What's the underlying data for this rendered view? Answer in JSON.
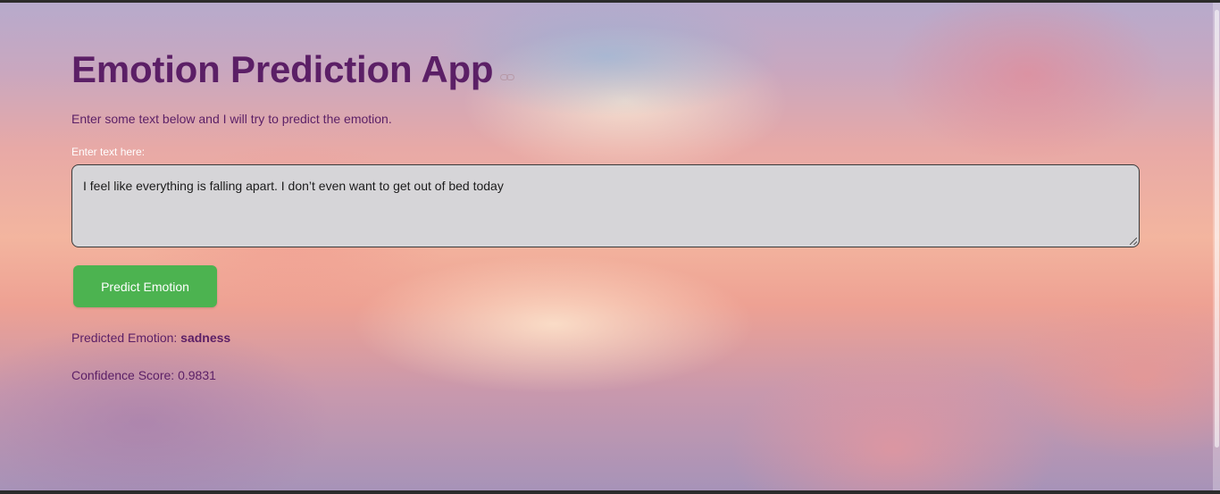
{
  "app": {
    "title": "Emotion Prediction App",
    "subtitle": "Enter some text below and I will try to predict the emotion."
  },
  "input": {
    "label": "Enter text here:",
    "value": "I feel like everything is falling apart. I don’t even want to get out of bed today"
  },
  "button": {
    "label": "Predict Emotion",
    "color": "#4cb350"
  },
  "result": {
    "emotion_prefix": "Predicted Emotion:",
    "emotion_value": "sadness",
    "confidence_prefix": "Confidence Score:",
    "confidence_value": "0.9831"
  },
  "colors": {
    "title": "#5b1f66",
    "textarea_bg": "#d6d5d8"
  },
  "icons": {
    "anchor": "link-icon"
  }
}
